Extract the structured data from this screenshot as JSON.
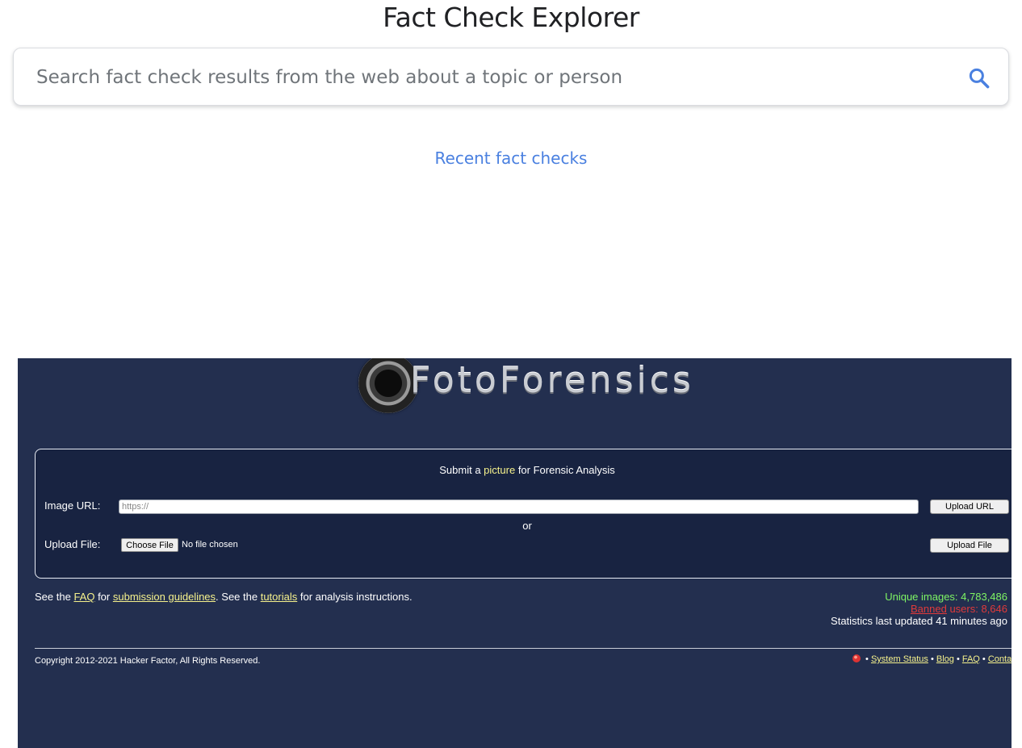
{
  "fact_check": {
    "title": "Fact Check Explorer",
    "search_placeholder": "Search fact check results from the web about a topic or person",
    "search_icon": "search-icon",
    "recent_link": "Recent fact checks",
    "accent_color": "#4a80e0"
  },
  "fotoforensics": {
    "logo_text": "FotoForensics",
    "submit_heading_before": "Submit a ",
    "submit_heading_highlight": "picture",
    "submit_heading_after": " for Forensic Analysis",
    "image_url_label": "Image URL:",
    "url_placeholder": "https://",
    "upload_url_button": "Upload URL",
    "or_text": "or",
    "upload_file_label": "Upload File:",
    "choose_file_button": "Choose File",
    "no_file_text": "No file chosen",
    "upload_file_button": "Upload File",
    "info": {
      "t1": "See the ",
      "faq": "FAQ",
      "t2": " for ",
      "guidelines": "submission guidelines",
      "t3": ". See the ",
      "tutorials": "tutorials",
      "t4": " for analysis instructions."
    },
    "stats": {
      "unique_images": "Unique images: 4,783,486",
      "banned_link": "Banned",
      "banned_rest": " users: 8,646",
      "updated": "Statistics last updated 41 minutes ago"
    },
    "copyright": "Copyright 2012-2021 Hacker Factor, All Rights Reserved.",
    "footer_links": {
      "sep": " • ",
      "system_status": "System Status",
      "blog": "Blog",
      "faq": "FAQ",
      "contact": "Conta"
    },
    "colors": {
      "background": "#232f4f",
      "highlight": "#f6f28c",
      "unique_green": "#7ef564",
      "banned_red": "#e03a3a"
    }
  }
}
